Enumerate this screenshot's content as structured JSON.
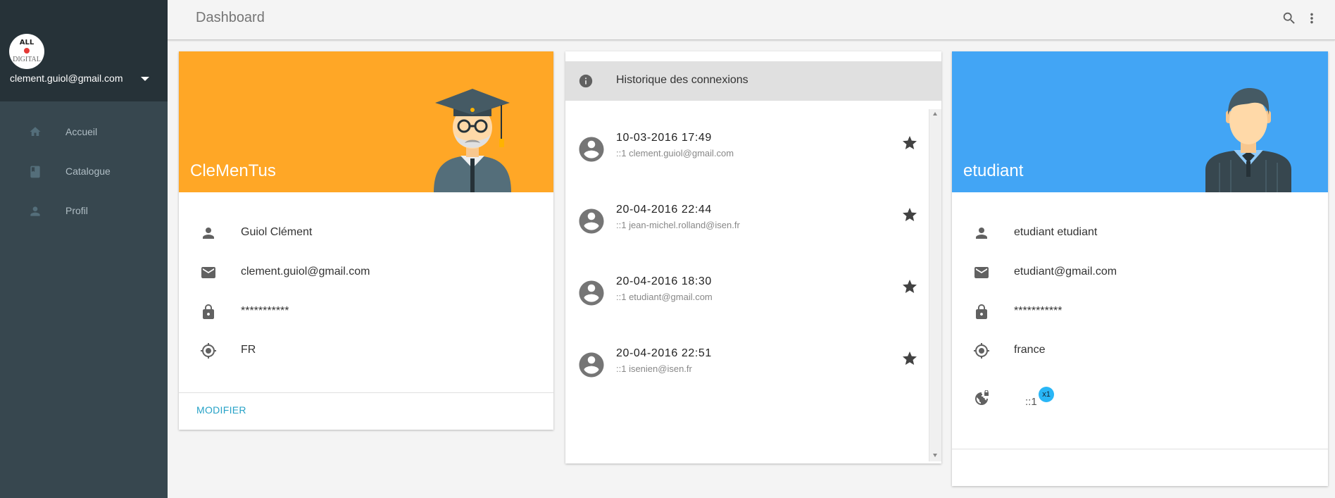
{
  "sidebar": {
    "logo_line1": "ALL",
    "logo_line2": "DIGITAL",
    "account_email": "clement.guiol@gmail.com",
    "items": [
      {
        "label": "Accueil",
        "icon": "home-icon"
      },
      {
        "label": "Catalogue",
        "icon": "book-icon"
      },
      {
        "label": "Profil",
        "icon": "person-icon"
      }
    ]
  },
  "header": {
    "title": "Dashboard"
  },
  "profile_card": {
    "name": "CleMenTus",
    "header_color": "#ffa726",
    "full_name": "Guiol Clément",
    "email": "clement.guiol@gmail.com",
    "password": "***********",
    "country": "FR",
    "modify_label": "MODIFIER"
  },
  "history": {
    "title": "Historique des connexions",
    "items": [
      {
        "datetime": "10-03-2016 17:49",
        "detail": "::1 clement.guiol@gmail.com"
      },
      {
        "datetime": "20-04-2016 22:44",
        "detail": "::1 jean-michel.rolland@isen.fr"
      },
      {
        "datetime": "20-04-2016 18:30",
        "detail": "::1 etudiant@gmail.com"
      },
      {
        "datetime": "20-04-2016 22:51",
        "detail": "::1 isenien@isen.fr"
      }
    ]
  },
  "student_card": {
    "name": "etudiant",
    "header_color": "#42a5f5",
    "full_name": "etudiant etudiant",
    "email": "etudiant@gmail.com",
    "password": "***********",
    "country": "france",
    "ip": "::1",
    "ip_badge": "x1"
  }
}
